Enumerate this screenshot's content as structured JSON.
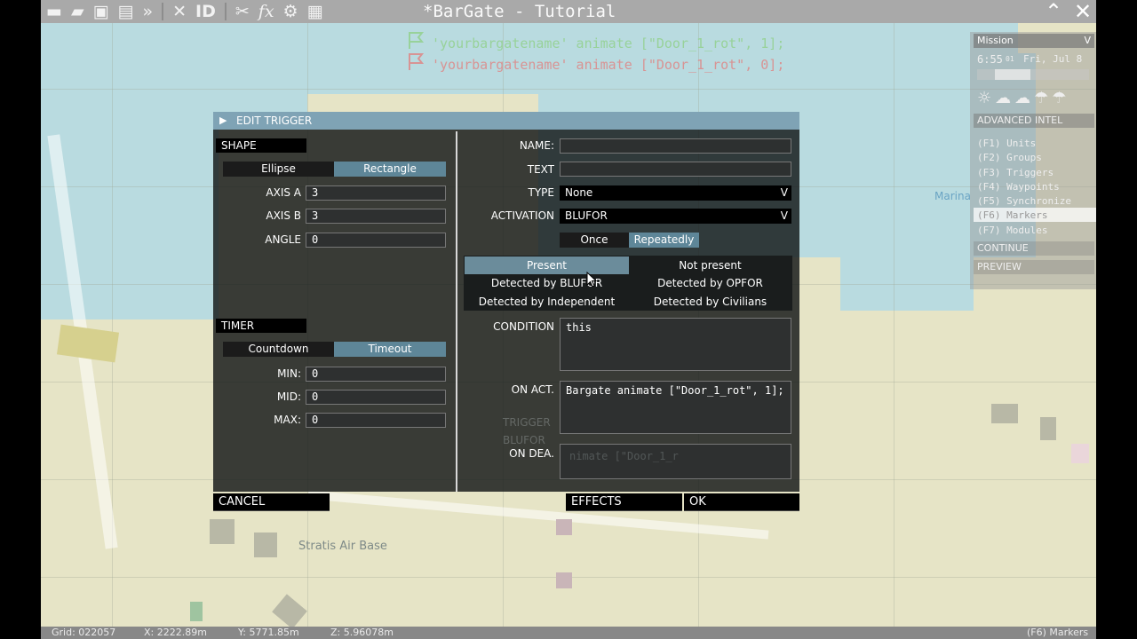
{
  "window": {
    "title": "*BarGate - Tutorial",
    "toolbar_icons": [
      "new-icon",
      "open-icon",
      "save-icon",
      "save-as-icon",
      "export-icon",
      "center-icon",
      "id-icon",
      "tools-icon",
      "function-icon",
      "gear-icon",
      "layout-icon"
    ],
    "id_label": "ID",
    "fx_label": "fx",
    "minimize_glyph": "⌃",
    "close_glyph": "✕"
  },
  "map": {
    "flag_line_1": "'yourbargatename' animate [\"Door_1_rot\", 1];",
    "flag_line_2": "'yourbargatename' animate [\"Door_1_rot\", 0];",
    "label_air_base": "Stratis Air Base",
    "label_marina": "Marina",
    "bg_trigger": "TRIGGER",
    "bg_blufor": "BLUFOR",
    "bg_ondea_text": "nimate [\"Door_1_r"
  },
  "status": {
    "grid": "Grid: 022057",
    "x": "X: 2222.89m",
    "y": "Y: 5771.85m",
    "z": "Z: 5.96078m",
    "mode": "(F6) Markers"
  },
  "right_panel": {
    "header": "Mission",
    "time": "6:55",
    "time_seconds": "01",
    "date": "Fri, Jul 8",
    "advanced_intel": "ADVANCED INTEL",
    "modes": [
      "(F1) Units",
      "(F2) Groups",
      "(F3) Triggers",
      "(F4) Waypoints",
      "(F5) Synchronize",
      "(F6) Markers",
      "(F7) Modules"
    ],
    "continue": "CONTINUE",
    "preview": "PREVIEW"
  },
  "dialog": {
    "title": "EDIT TRIGGER",
    "shape_header": "SHAPE",
    "shape_ellipse": "Ellipse",
    "shape_rectangle": "Rectangle",
    "axis_a_label": "AXIS A",
    "axis_a_value": "3",
    "axis_b_label": "AXIS B",
    "axis_b_value": "3",
    "angle_label": "ANGLE",
    "angle_value": "0",
    "timer_header": "TIMER",
    "timer_countdown": "Countdown",
    "timer_timeout": "Timeout",
    "min_label": "MIN:",
    "min_value": "0",
    "mid_label": "MID:",
    "mid_value": "0",
    "max_label": "MAX:",
    "max_value": "0",
    "name_label": "NAME:",
    "name_value": "",
    "text_label": "TEXT",
    "text_value": "",
    "type_label": "TYPE",
    "type_value": "None",
    "activation_label": "ACTIVATION",
    "activation_value": "BLUFOR",
    "once": "Once",
    "repeatedly": "Repeatedly",
    "present": "Present",
    "not_present": "Not present",
    "det_blufor": "Detected by BLUFOR",
    "det_opfor": "Detected by OPFOR",
    "det_independent": "Detected by Independent",
    "det_civilians": "Detected by Civilians",
    "condition_label": "CONDITION",
    "condition_value": "this",
    "on_act_label": "ON ACT.",
    "on_act_value": "Bargate animate [\"Door_1_rot\", 1];",
    "on_dea_label": "ON DEA.",
    "on_dea_value": "",
    "cancel": "CANCEL",
    "effects": "EFFECTS",
    "ok": "OK",
    "dropdown_glyph": "V"
  }
}
